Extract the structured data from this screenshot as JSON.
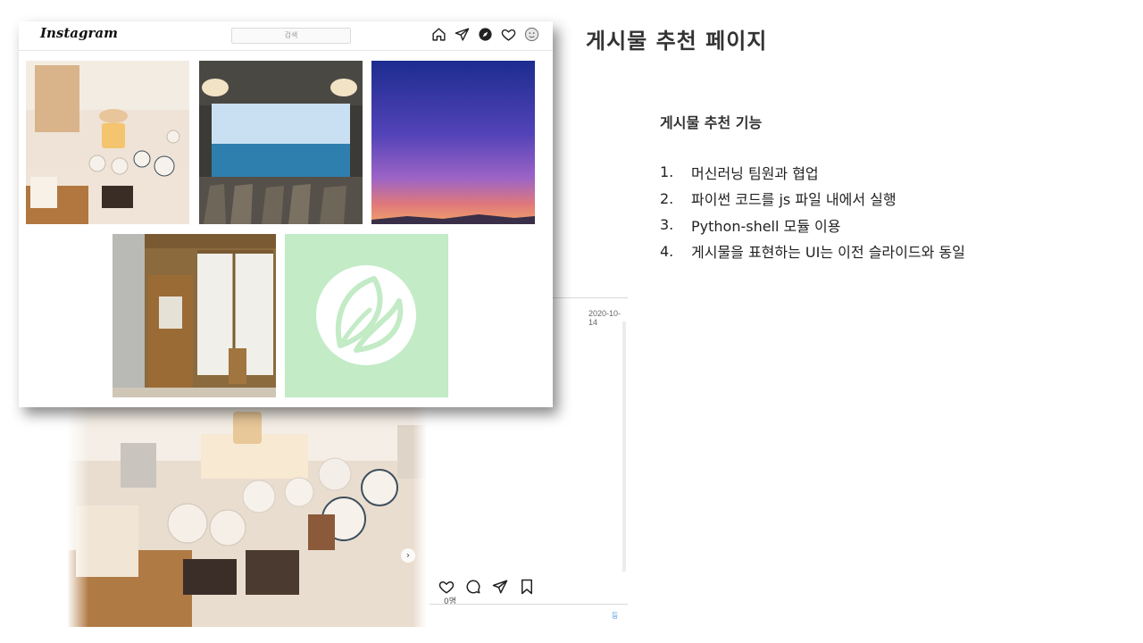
{
  "slide": {
    "title": "게시물 추천 페이지",
    "section_title": "게시물 추천 기능",
    "features": [
      {
        "num": "1.",
        "text": "머신러닝 팀원과 협업"
      },
      {
        "num": "2.",
        "text": "파이썬 코드를 js 파일 내에서 실행"
      },
      {
        "num": "3.",
        "text": "Python-shell 모듈 이용"
      },
      {
        "num": "4.",
        "text": "게시물을 표현하는 UI는 이전 슬라이드와 동일"
      }
    ]
  },
  "explore": {
    "logo": "Instagram",
    "search_placeholder": "검색",
    "nav_icons": [
      "home-icon",
      "direct-icon",
      "explore-icon",
      "activity-heart-icon",
      "profile-avatar-icon"
    ],
    "tiles": [
      "pottery-shop-photo",
      "ocean-view-cafe-photo",
      "sunset-sky-photo",
      "wooden-door-storefront-photo",
      "leaf-logo-placeholder"
    ],
    "accent_color": "#c2ebc6"
  },
  "post": {
    "date": "2020-10-14",
    "likes": "0명",
    "action_icons": [
      "like-heart-icon",
      "comment-icon",
      "share-icon",
      "bookmark-icon"
    ],
    "link_fragment": "등"
  }
}
